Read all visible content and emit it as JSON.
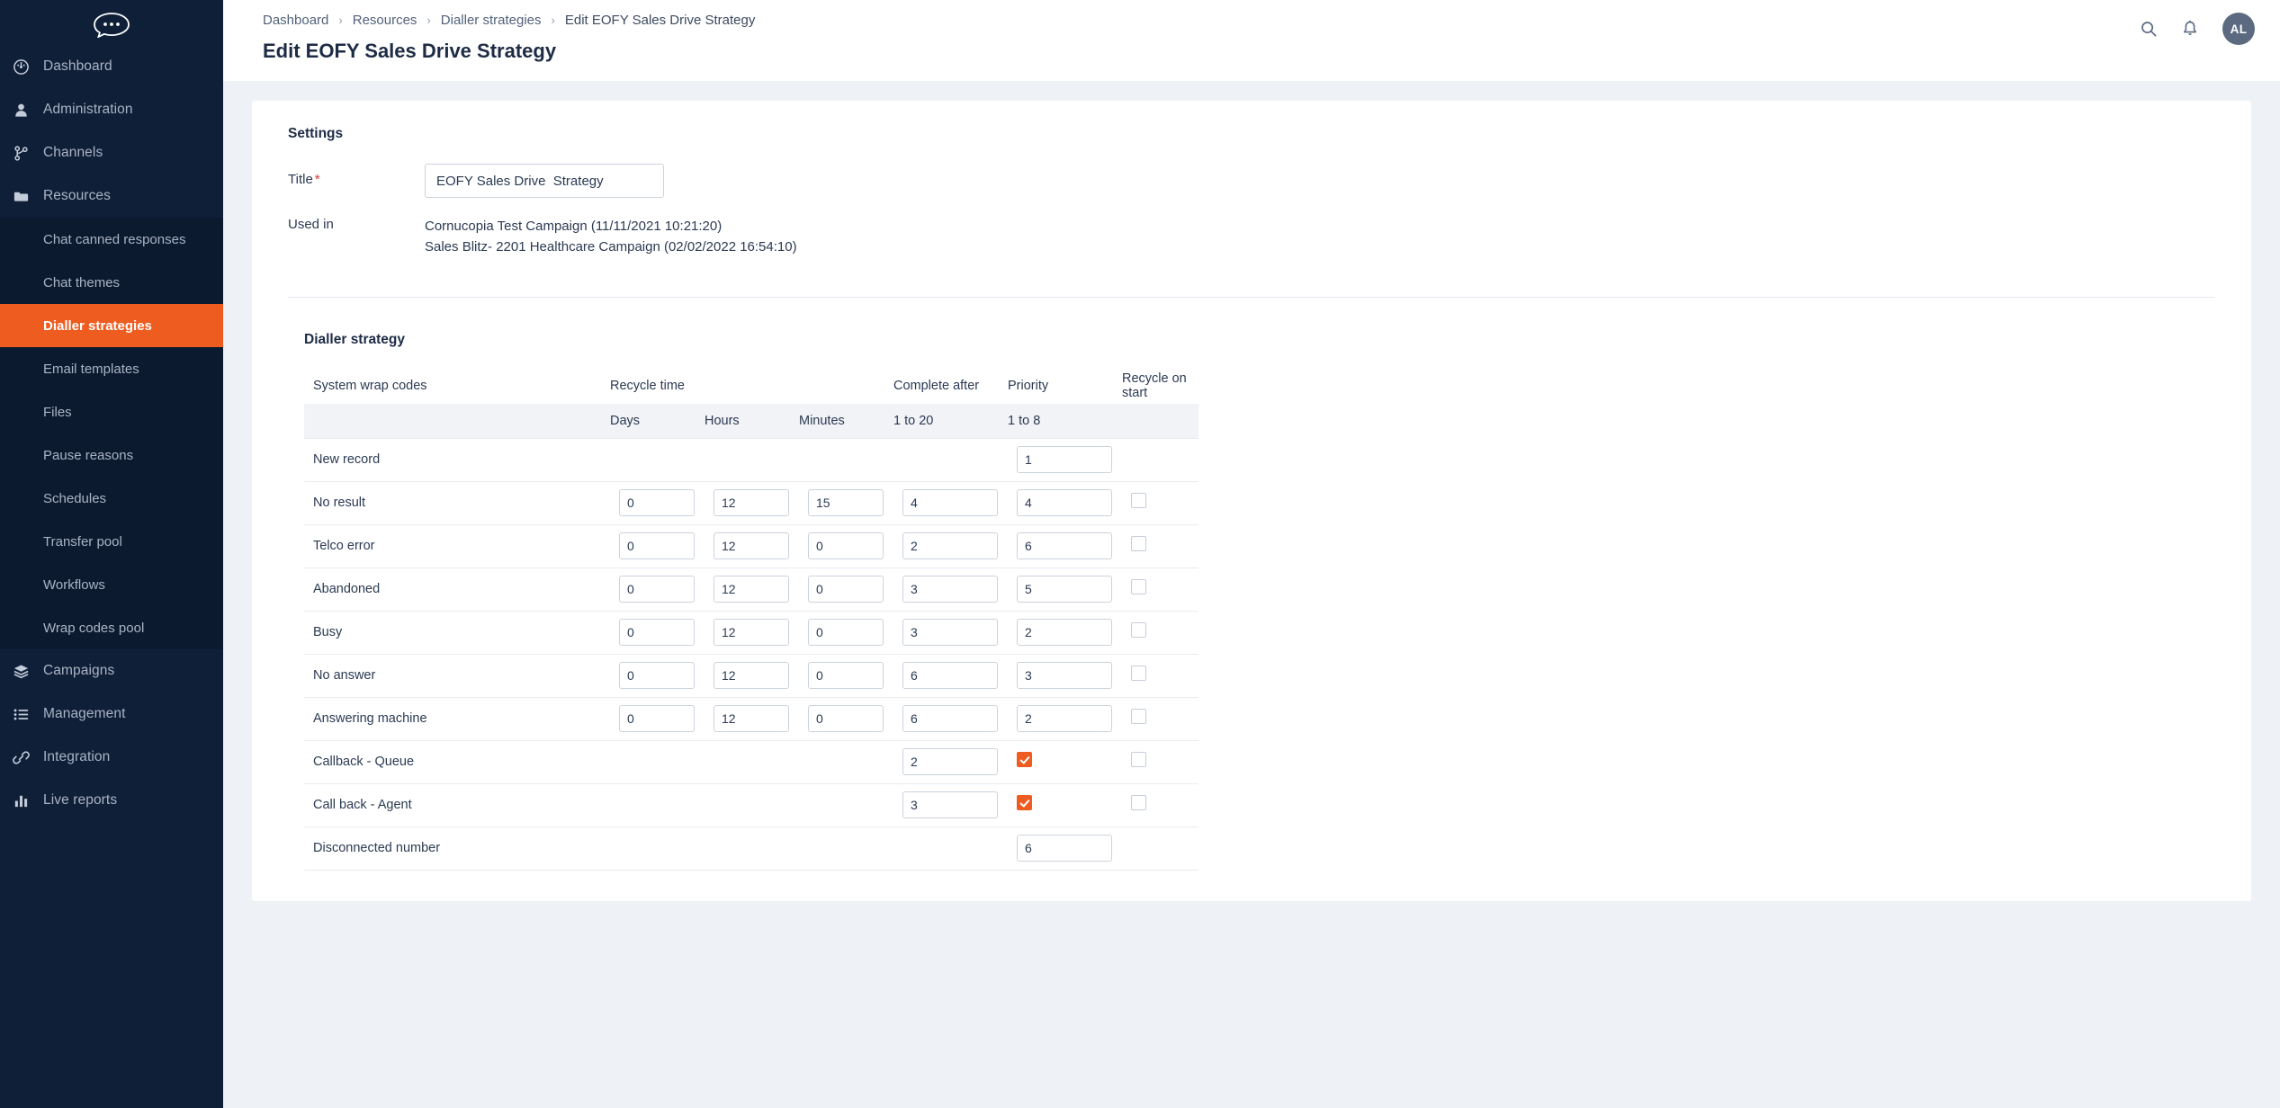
{
  "brand": {
    "logo_icon": "chat-bubble-logo",
    "accent_color": "#ef5c20",
    "sidebar_color": "#101f38"
  },
  "sidebar": {
    "items": [
      {
        "label": "Dashboard",
        "icon": "gauge-icon"
      },
      {
        "label": "Administration",
        "icon": "person-icon"
      },
      {
        "label": "Channels",
        "icon": "branch-icon"
      },
      {
        "label": "Resources",
        "icon": "folder-icon"
      }
    ],
    "resources_children": [
      {
        "label": "Chat canned responses",
        "active": false
      },
      {
        "label": "Chat themes",
        "active": false
      },
      {
        "label": "Dialler strategies",
        "active": true
      },
      {
        "label": "Email templates",
        "active": false
      },
      {
        "label": "Files",
        "active": false
      },
      {
        "label": "Pause reasons",
        "active": false
      },
      {
        "label": "Schedules",
        "active": false
      },
      {
        "label": "Transfer pool",
        "active": false
      },
      {
        "label": "Workflows",
        "active": false
      },
      {
        "label": "Wrap codes pool",
        "active": false
      }
    ],
    "items_bottom": [
      {
        "label": "Campaigns",
        "icon": "layers-icon"
      },
      {
        "label": "Management",
        "icon": "list-icon"
      },
      {
        "label": "Integration",
        "icon": "link-icon"
      },
      {
        "label": "Live reports",
        "icon": "bar-chart-icon"
      }
    ]
  },
  "header": {
    "breadcrumb": [
      "Dashboard",
      "Resources",
      "Dialler strategies",
      "Edit EOFY Sales Drive Strategy"
    ],
    "separator": "›",
    "page_title": "Edit EOFY Sales Drive Strategy",
    "search_icon": "search-icon",
    "notification_icon": "bell-icon",
    "avatar_initials": "AL"
  },
  "settings": {
    "section_title": "Settings",
    "title_label": "Title",
    "required_mark": "*",
    "title_value": "EOFY Sales Drive  Strategy",
    "title_placeholder": "Title",
    "used_in_label": "Used in",
    "used_in": [
      "Cornucopia Test Campaign (11/11/2021 10:21:20)",
      "Sales Blitz- 2201 Healthcare Campaign (02/02/2022 16:54:10)"
    ]
  },
  "strategy": {
    "section_title": "Dialler strategy",
    "headers": {
      "name": "System wrap codes",
      "recycle_time": "Recycle time",
      "complete_after": "Complete after",
      "priority": "Priority",
      "recycle_on_start": "Recycle on start"
    },
    "subheaders": {
      "days": "Days",
      "hours": "Hours",
      "minutes": "Minutes",
      "complete_after_range": "1 to 20",
      "priority_range": "1 to 8",
      "recycle_on_start": ""
    },
    "rows": [
      {
        "name": "New record",
        "days": null,
        "hours": null,
        "minutes": null,
        "complete_after": null,
        "priority": "1",
        "priority_type": "input",
        "recycle_on_start": null
      },
      {
        "name": "No result",
        "days": "0",
        "hours": "12",
        "minutes": "15",
        "complete_after": "4",
        "priority": "4",
        "priority_type": "input",
        "recycle_on_start": false
      },
      {
        "name": "Telco error",
        "days": "0",
        "hours": "12",
        "minutes": "0",
        "complete_after": "2",
        "priority": "6",
        "priority_type": "input",
        "recycle_on_start": false
      },
      {
        "name": "Abandoned",
        "days": "0",
        "hours": "12",
        "minutes": "0",
        "complete_after": "3",
        "priority": "5",
        "priority_type": "input",
        "recycle_on_start": false
      },
      {
        "name": "Busy",
        "days": "0",
        "hours": "12",
        "minutes": "0",
        "complete_after": "3",
        "priority": "2",
        "priority_type": "input",
        "recycle_on_start": false
      },
      {
        "name": "No answer",
        "days": "0",
        "hours": "12",
        "minutes": "0",
        "complete_after": "6",
        "priority": "3",
        "priority_type": "input",
        "recycle_on_start": false
      },
      {
        "name": "Answering machine",
        "days": "0",
        "hours": "12",
        "minutes": "0",
        "complete_after": "6",
        "priority": "2",
        "priority_type": "input",
        "recycle_on_start": false
      },
      {
        "name": "Callback - Queue",
        "days": null,
        "hours": null,
        "minutes": null,
        "complete_after": "2",
        "priority": true,
        "priority_type": "checkbox",
        "recycle_on_start": false
      },
      {
        "name": "Call back - Agent",
        "days": null,
        "hours": null,
        "minutes": null,
        "complete_after": "3",
        "priority": true,
        "priority_type": "checkbox",
        "recycle_on_start": false
      },
      {
        "name": "Disconnected number",
        "days": null,
        "hours": null,
        "minutes": null,
        "complete_after": null,
        "priority": "6",
        "priority_type": "input",
        "recycle_on_start": null
      }
    ]
  }
}
